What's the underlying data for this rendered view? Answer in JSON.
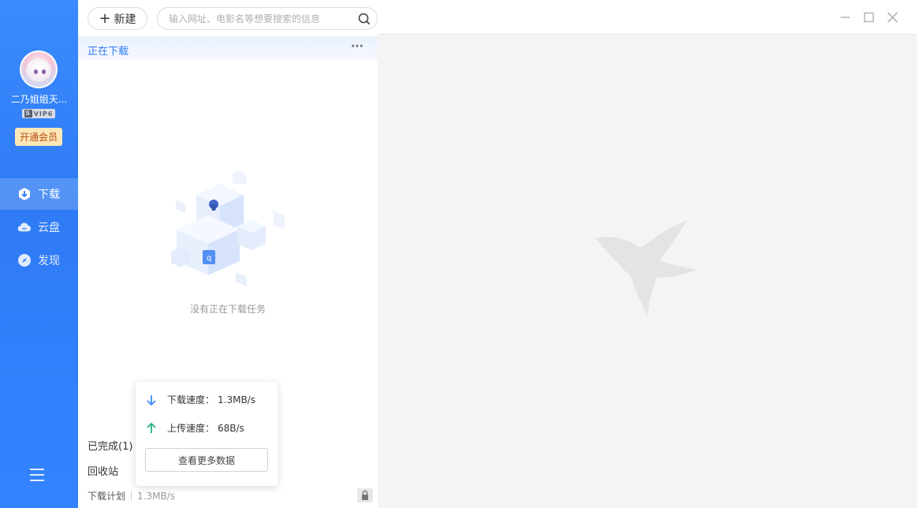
{
  "sidebar": {
    "username": "二乃姐姐天...",
    "vip_level": "VIP6",
    "vip_prefix": "S",
    "open_vip_label": "开通会员",
    "nav": [
      {
        "label": "下载",
        "icon": "download-icon",
        "active": true
      },
      {
        "label": "云盘",
        "icon": "cloud-icon",
        "active": false
      },
      {
        "label": "发现",
        "icon": "compass-icon",
        "active": false
      }
    ]
  },
  "toolbar": {
    "new_label": "新建",
    "search_placeholder": "输入网址、电影名等想要搜索的信息"
  },
  "list": {
    "section_title": "正在下载",
    "more": "···",
    "empty_text": "没有正在下载任务",
    "completed_label": "已完成(1)",
    "recycle_label": "回收站",
    "plan_label": "下载计划",
    "plan_speed": "1.3MB/s"
  },
  "popover": {
    "download_label": "下载速度：",
    "download_value": "1.3MB/s",
    "upload_label": "上传速度：",
    "upload_value": "68B/s",
    "more_button": "查看更多数据"
  },
  "colors": {
    "accent": "#2f7bf5",
    "download_arrow": "#3d8af7",
    "upload_arrow": "#21b27c",
    "vip_button_bg": "#fde7b6"
  }
}
